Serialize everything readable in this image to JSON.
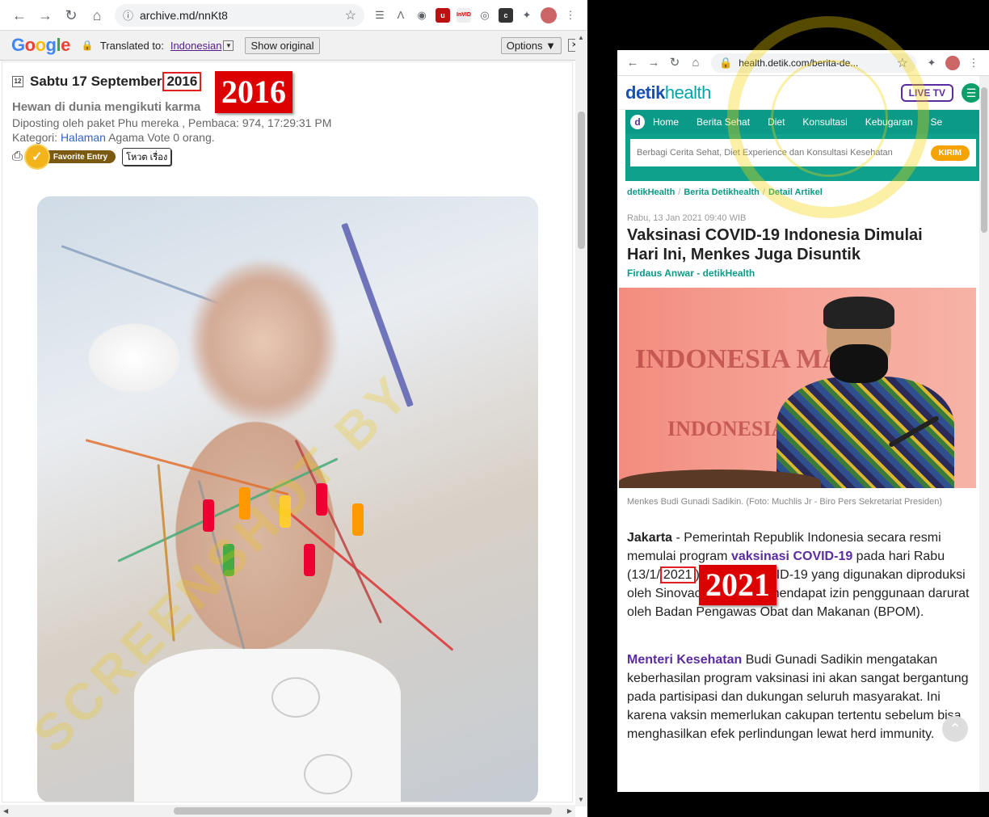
{
  "left_window": {
    "url": "archive.md/nnKt8",
    "translate_bar": {
      "translated_to_label": "Translated to:",
      "language": "Indonesian",
      "show_original": "Show original",
      "options": "Options ▼"
    },
    "post": {
      "date_prefix": "Sabtu 17 September",
      "year": "2016",
      "subtitle": "Hewan di dunia mengikuti karma",
      "meta_line": "Diposting oleh paket Phu mereka , Pembaca: 974, 17:29:31 PM",
      "category_label": "Kategori:",
      "category_link": "Halaman",
      "category_rest": "Agama Vote 0 orang.",
      "favorite": "Favorite Entry",
      "thai_button": "โหวต เรื่อง"
    },
    "stamp": "2016"
  },
  "right_window": {
    "url": "health.detik.com/berita-de...",
    "logo_main": "detik",
    "logo_sub": "health",
    "live_tv": "LIVE TV",
    "nav": [
      "Home",
      "Berita Sehat",
      "Diet",
      "Konsultasi",
      "Kebugaran",
      "Se"
    ],
    "input_placeholder": "Berbagi Cerita Sehat, Diet Experience dan Konsultasi Kesehatan",
    "kirim": "KIRIM",
    "breadcrumbs": [
      "detikHealth",
      "Berita Detikhealth",
      "Detail Artikel"
    ],
    "date": "Rabu, 13 Jan 2021 09:40 WIB",
    "title": "Vaksinasi COVID-19 Indonesia Dimulai Hari Ini, Menkes Juga Disuntik",
    "author": "Firdaus Anwar - detikHealth",
    "hero_texts": [
      "INDONESIA MAJU",
      "INDONESIA MAJU"
    ],
    "caption": "Menkes Budi Gunadi Sadikin. (Foto: Muchlis Jr - Biro Pers Sekretariat Presiden)",
    "p1_city": "Jakarta",
    "p1_a": " - Pemerintah Republik Indonesia secara resmi memulai program ",
    "p1_link": "vaksinasi COVID-19",
    "p1_b": " pada hari Rabu (13/1/",
    "p1_year": "2021",
    "p1_c": "). Vaksin COVID-19 yang digunakan diproduksi oleh Sinovac dan sudah mendapat izin penggunaan darurat oleh Badan Pengawas Obat dan Makanan (BPOM).",
    "p2_link": "Menteri Kesehatan",
    "p2_rest": " Budi Gunadi Sadikin mengatakan keberhasilan program vaksinasi ini akan sangat bergantung pada partisipasi dan dukungan seluruh masyarakat. Ini karena vaksin memerlukan cakupan tertentu sebelum bisa menghasilkan efek perlindungan lewat herd immunity.",
    "stamp": "2021"
  },
  "watermark": "SCREENSHOT BY",
  "colors": {
    "stamp_red": "#dd0000",
    "detik_teal": "#0b9a87",
    "detik_purple": "#5b2ca0"
  }
}
